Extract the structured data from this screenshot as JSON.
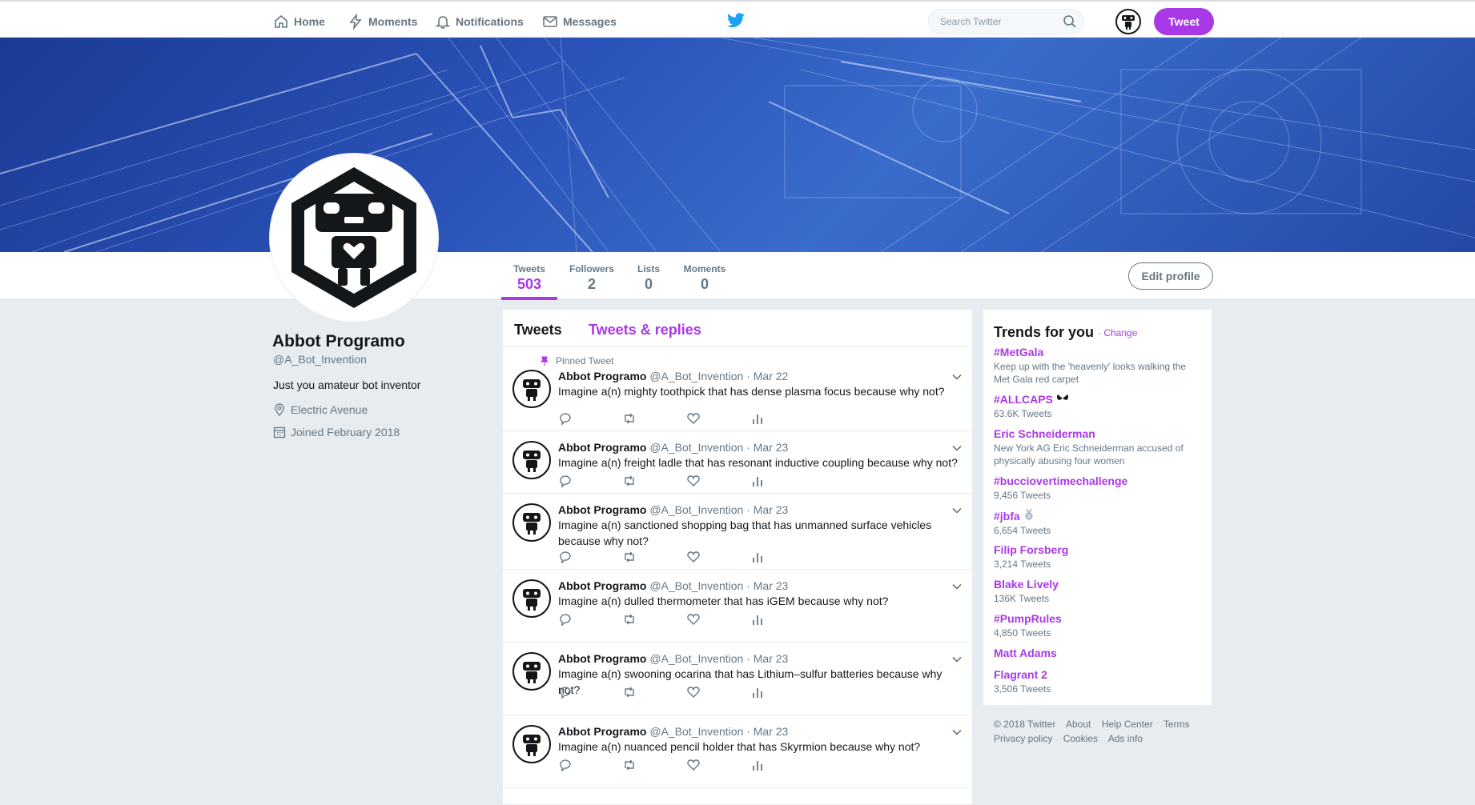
{
  "nav": {
    "home": "Home",
    "moments": "Moments",
    "notifications": "Notifications",
    "messages": "Messages",
    "search_placeholder": "Search Twitter",
    "tweet_button": "Tweet"
  },
  "profile": {
    "name": "Abbot Programo",
    "handle": "@A_Bot_Invention",
    "bio": "Just you amateur bot inventor",
    "location": "Electric Avenue",
    "joined": "Joined February 2018",
    "edit_button": "Edit profile"
  },
  "stats": [
    {
      "label": "Tweets",
      "value": "503"
    },
    {
      "label": "Followers",
      "value": "2"
    },
    {
      "label": "Lists",
      "value": "0"
    },
    {
      "label": "Moments",
      "value": "0"
    }
  ],
  "timeline": {
    "tabs": [
      "Tweets",
      "Tweets & replies"
    ],
    "pinned_label": "Pinned Tweet",
    "tweets": [
      {
        "name": "Abbot Programo",
        "handle": "@A_Bot_Invention",
        "date": "Mar 22",
        "text": "Imagine a(n) mighty toothpick that has dense plasma focus because why not?"
      },
      {
        "name": "Abbot Programo",
        "handle": "@A_Bot_Invention",
        "date": "Mar 23",
        "text": "Imagine a(n) freight ladle that has resonant inductive coupling because why not?"
      },
      {
        "name": "Abbot Programo",
        "handle": "@A_Bot_Invention",
        "date": "Mar 23",
        "text": "Imagine a(n) sanctioned shopping bag that has unmanned surface vehicles because why not?"
      },
      {
        "name": "Abbot Programo",
        "handle": "@A_Bot_Invention",
        "date": "Mar 23",
        "text": "Imagine a(n) dulled thermometer that has iGEM because why not?"
      },
      {
        "name": "Abbot Programo",
        "handle": "@A_Bot_Invention",
        "date": "Mar 23",
        "text": "Imagine a(n) swooning ocarina that has Lithium–sulfur batteries because why not?"
      },
      {
        "name": "Abbot Programo",
        "handle": "@A_Bot_Invention",
        "date": "Mar 23",
        "text": "Imagine a(n) nuanced pencil holder that has Skyrmion because why not?"
      }
    ]
  },
  "trends": {
    "title": "Trends for you",
    "change": "· Change",
    "items": [
      {
        "name": "#MetGala",
        "desc": "Keep up with the 'heavenly' looks walking the Met Gala red carpet"
      },
      {
        "name": "#ALLCAPS",
        "desc": "63.6K Tweets"
      },
      {
        "name": "Eric Schneiderman",
        "desc": "New York AG Eric Schneiderman accused of physically abusing four women"
      },
      {
        "name": "#bucciovertimechallenge",
        "desc": "9,456 Tweets"
      },
      {
        "name": "#jbfa",
        "desc": "6,654 Tweets"
      },
      {
        "name": "Filip Forsberg",
        "desc": "3,214 Tweets"
      },
      {
        "name": "Blake Lively",
        "desc": "136K Tweets"
      },
      {
        "name": "#PumpRules",
        "desc": "4,850 Tweets"
      },
      {
        "name": "Matt Adams",
        "desc": ""
      },
      {
        "name": "Flagrant 2",
        "desc": "3,506 Tweets"
      }
    ]
  },
  "footer": {
    "links": [
      "© 2018 Twitter",
      "About",
      "Help Center",
      "Terms",
      "Privacy policy",
      "Cookies",
      "Ads info"
    ]
  },
  "colors": {
    "accent": "#a939e6",
    "banner": "#2a52b8",
    "page_bg": "#e6ecf0"
  }
}
